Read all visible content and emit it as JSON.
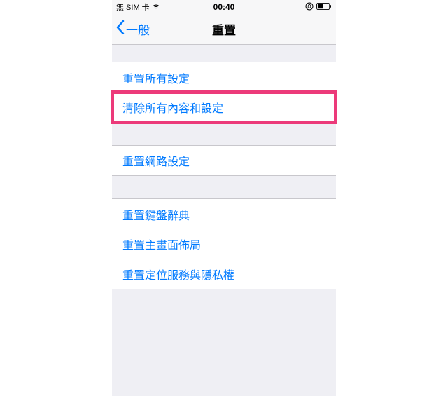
{
  "status_bar": {
    "carrier": "無 SIM 卡",
    "time": "00:40"
  },
  "nav": {
    "back_label": "一般",
    "title": "重置"
  },
  "groups": [
    {
      "items": [
        {
          "label": "重置所有設定",
          "highlight": false
        },
        {
          "label": "清除所有內容和設定",
          "highlight": true
        }
      ]
    },
    {
      "items": [
        {
          "label": "重置網路設定",
          "highlight": false
        }
      ]
    },
    {
      "items": [
        {
          "label": "重置鍵盤辭典",
          "highlight": false
        },
        {
          "label": "重置主畫面佈局",
          "highlight": false
        },
        {
          "label": "重置定位服務與隱私權",
          "highlight": false
        }
      ]
    }
  ]
}
